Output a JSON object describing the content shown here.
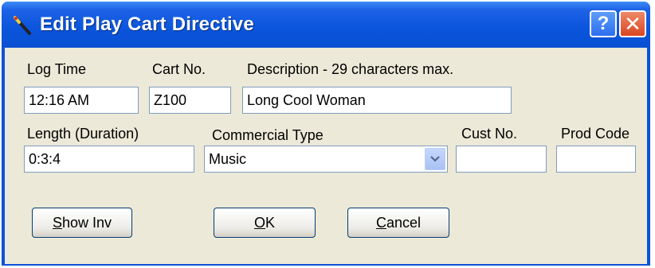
{
  "window": {
    "title": "Edit Play Cart Directive",
    "help_label": "?",
    "close_label": "✕"
  },
  "fields": {
    "log_time": {
      "label": "Log Time",
      "value": "12:16 AM"
    },
    "cart_no": {
      "label": "Cart No.",
      "value": "Z100"
    },
    "description": {
      "label": "Description - 29 characters max.",
      "value": "Long Cool Woman"
    },
    "length": {
      "label": "Length (Duration)",
      "value": "0:3:4"
    },
    "commercial_type": {
      "label": "Commercial Type",
      "value": "Music"
    },
    "cust_no": {
      "label": "Cust No.",
      "value": ""
    },
    "prod_code": {
      "label": "Prod Code",
      "value": ""
    }
  },
  "buttons": {
    "show_inv": {
      "mnemonic": "S",
      "rest": "how Inv"
    },
    "ok": {
      "mnemonic": "O",
      "rest": "K"
    },
    "cancel": {
      "mnemonic": "C",
      "rest": "ancel"
    }
  },
  "icons": {
    "app": "wand-icon",
    "dropdown": "chevron-down-icon"
  },
  "colors": {
    "title_bar": "#0a53d8",
    "dialog_bg": "#ece9d8",
    "field_border": "#7f9db9",
    "close_button": "#d84621"
  }
}
